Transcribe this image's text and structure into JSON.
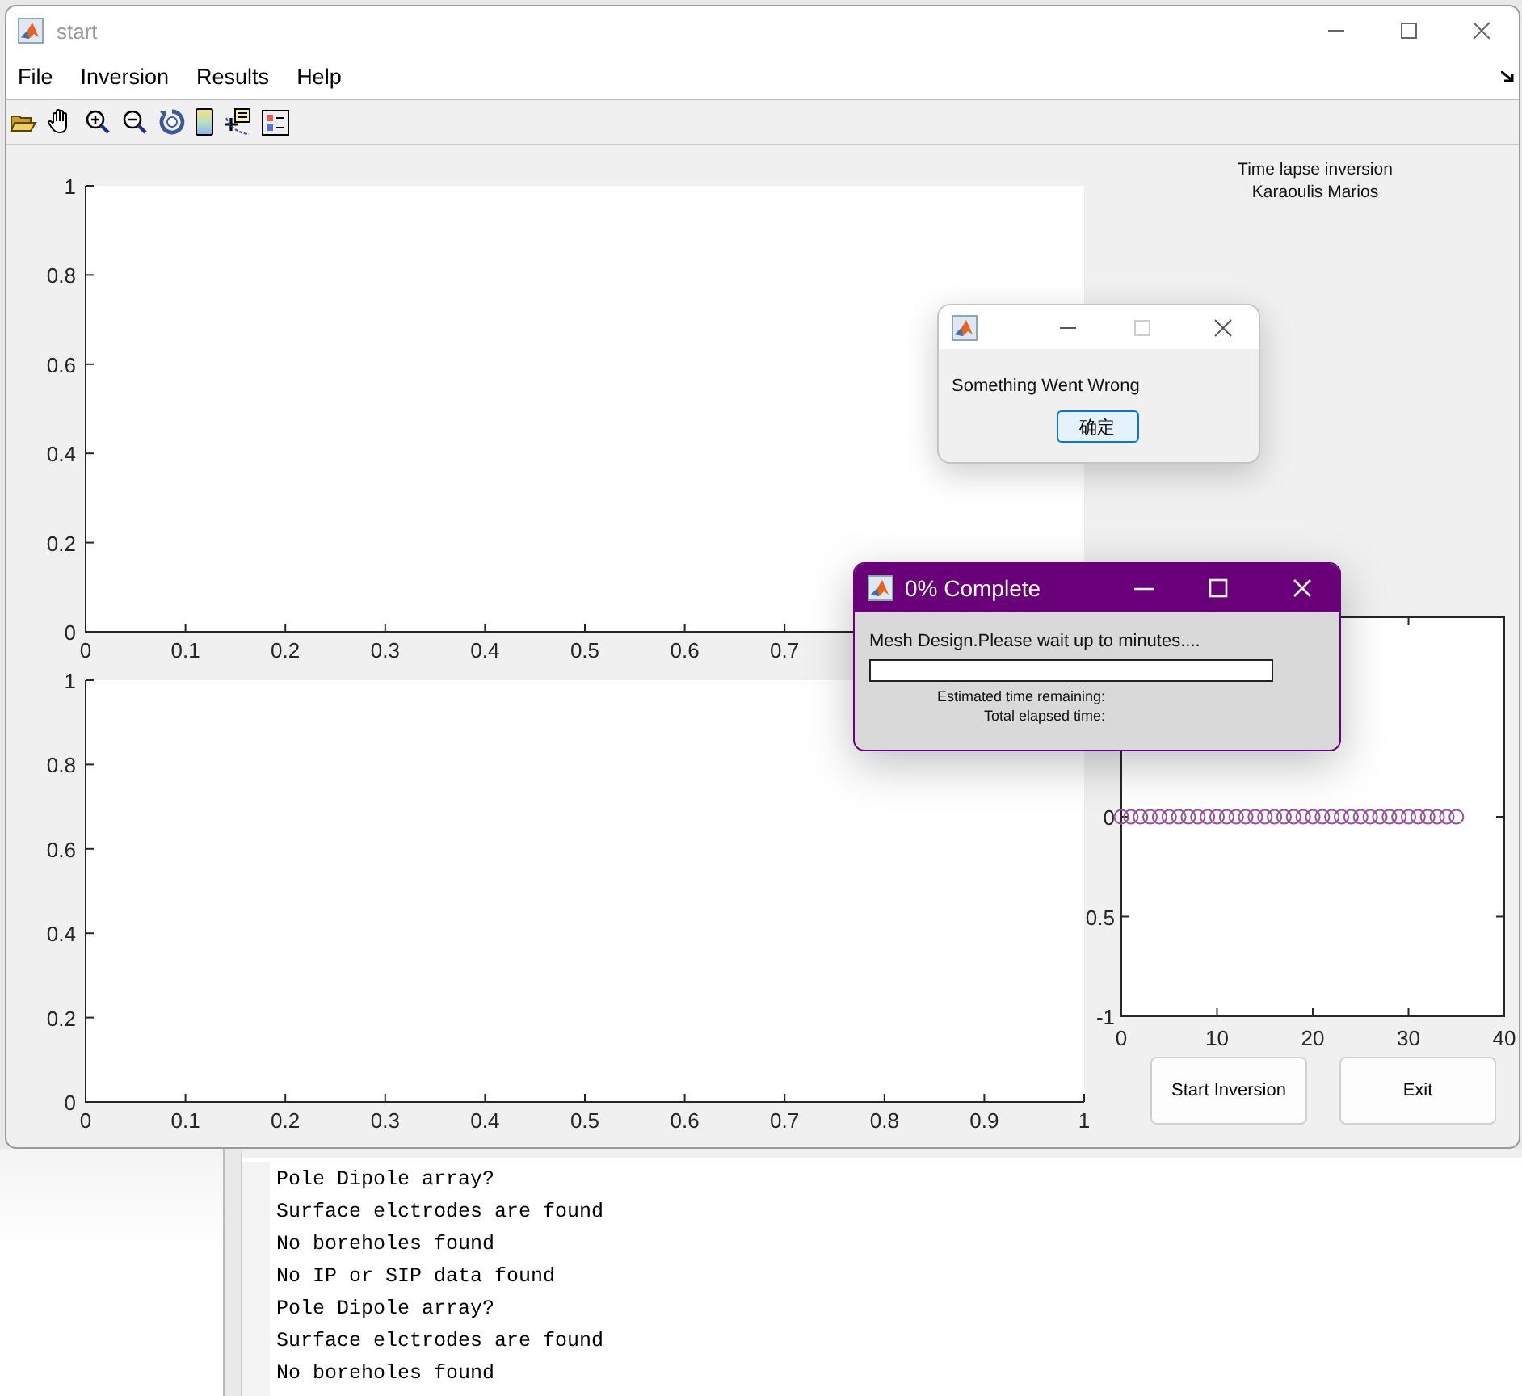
{
  "window": {
    "title": "start"
  },
  "menu": [
    "File",
    "Inversion",
    "Results",
    "Help"
  ],
  "author": [
    "Time lapse inversion",
    "Karaoulis Marios"
  ],
  "charts": [
    {
      "chart_data": {
        "type": "line",
        "xlim": [
          0,
          1
        ],
        "ylim": [
          0,
          1
        ],
        "xticks": [
          0,
          0.1,
          0.2,
          0.3,
          0.4,
          0.5,
          0.6,
          0.7
        ],
        "yticks": [
          0,
          0.2,
          0.4,
          0.6,
          0.8,
          1
        ]
      }
    },
    {
      "chart_data": {
        "type": "line",
        "xlim": [
          0,
          1
        ],
        "ylim": [
          0,
          1
        ],
        "xticks": [
          0,
          0.1,
          0.2,
          0.3,
          0.4,
          0.5,
          0.6,
          0.7,
          0.8,
          0.9,
          1
        ],
        "yticks": [
          0,
          0.2,
          0.4,
          0.6,
          0.8,
          1
        ]
      }
    },
    {
      "chart_data": {
        "type": "scatter",
        "xlim": [
          0,
          40
        ],
        "ylim": [
          -1,
          1
        ],
        "xticks": [
          0,
          10,
          20,
          30,
          40
        ],
        "yticks": [
          {
            "value": -1,
            "label": "-1"
          },
          {
            "value": -0.5,
            "label": "0.5"
          },
          0
        ],
        "x": [
          0,
          1,
          2,
          3,
          4,
          5,
          6,
          7,
          8,
          9,
          10,
          11,
          12,
          13,
          14,
          15,
          16,
          17,
          18,
          19,
          20,
          21,
          22,
          23,
          24,
          25,
          26,
          27,
          28,
          29,
          30,
          31,
          32,
          33,
          34,
          35
        ],
        "series": [
          {
            "color": "#9b4ca3",
            "values": [
              0,
              0,
              0,
              0,
              0,
              0,
              0,
              0,
              0,
              0,
              0,
              0,
              0,
              0,
              0,
              0,
              0,
              0,
              0,
              0,
              0,
              0,
              0,
              0,
              0,
              0,
              0,
              0,
              0,
              0,
              0,
              0,
              0,
              0,
              0,
              0
            ]
          }
        ]
      }
    }
  ],
  "buttons": [
    "Start Inversion",
    "Exit"
  ],
  "error_dialog": {
    "message": "Something Went Wrong",
    "button": "确定"
  },
  "progress_dialog": {
    "title": "0% Complete",
    "message": "Mesh Design.Please wait up to minutes....",
    "level": 0,
    "estimated_label": "Estimated time remaining:",
    "elapsed_label": "Total elapsed time:"
  },
  "command_window": {
    "lines": [
      "Pole Dipole array?",
      "Surface elctrodes are found",
      "No boreholes found",
      "No IP or SIP data found",
      "Pole Dipole array?",
      "Surface elctrodes are found",
      "No boreholes found"
    ]
  }
}
